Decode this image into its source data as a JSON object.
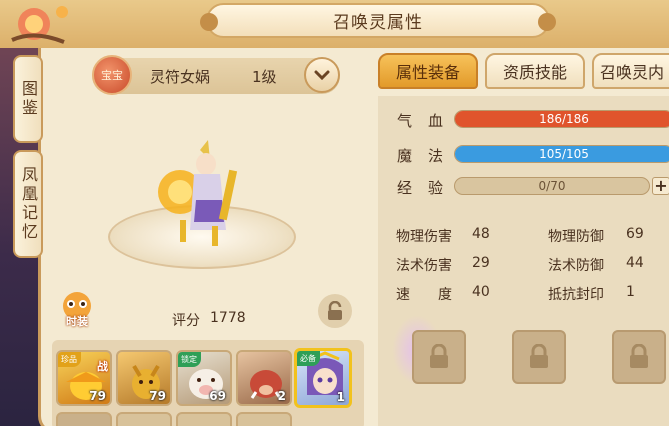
{
  "window": {
    "title": "召唤灵属性"
  },
  "side_tabs": [
    {
      "label": "图鉴"
    },
    {
      "label": "凤凰记忆"
    }
  ],
  "pet": {
    "badge": "宝宝",
    "name": "灵符女娲",
    "level": "1级",
    "score_label": "评分",
    "score": "1778"
  },
  "costume": {
    "label": "时装"
  },
  "tabs": [
    {
      "label": "属性装备",
      "active": true
    },
    {
      "label": "资质技能",
      "active": false
    },
    {
      "label": "召唤灵内",
      "active": false
    }
  ],
  "stats": {
    "hp": {
      "label_a": "气",
      "label_b": "血",
      "text": "186/186",
      "fraction": 1.0,
      "color": "#e0542c"
    },
    "mp": {
      "label_a": "魔",
      "label_b": "法",
      "text": "105/105",
      "fraction": 1.0,
      "color": "#3a9be0"
    },
    "exp": {
      "label_a": "经",
      "label_b": "验",
      "text": "0/70",
      "fraction": 0.0,
      "color": "#d8c29a"
    },
    "plus": "+"
  },
  "attributes": [
    {
      "label": "物理伤害",
      "value": "48"
    },
    {
      "label": "物理防御",
      "value": "69"
    },
    {
      "label": "法术伤害",
      "value": "29"
    },
    {
      "label": "法术防御",
      "value": "44"
    },
    {
      "label": "速　　度",
      "value": "40"
    },
    {
      "label": "抵抗封印",
      "value": "1"
    }
  ],
  "pet_slots": [
    {
      "level": "79",
      "ribbon": "珍品",
      "fight": "战",
      "art": "golden-bird"
    },
    {
      "level": "79",
      "ribbon": "",
      "fight": "",
      "art": "golden-dragon"
    },
    {
      "level": "69",
      "ribbon": "锁定",
      "fight": "",
      "art": "white-pig"
    },
    {
      "level": "2",
      "ribbon": "",
      "fight": "",
      "art": "boar"
    },
    {
      "level": "1",
      "ribbon": "必备",
      "fight": "",
      "art": "nuwa"
    }
  ]
}
